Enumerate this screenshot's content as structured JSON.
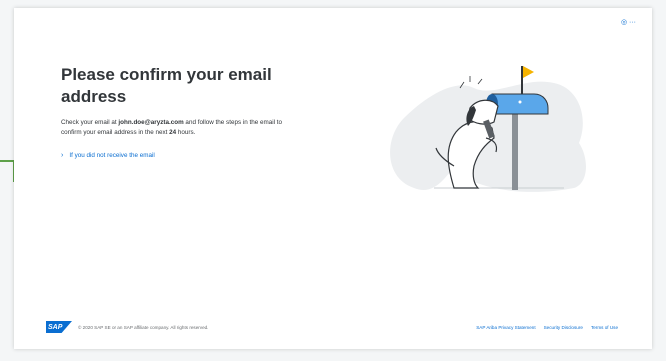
{
  "header": {
    "corner_icon": "settings-icon",
    "corner_glyph": "◎ ···"
  },
  "main": {
    "title": "Please confirm your email address",
    "desc_prefix": "Check your email at ",
    "email": "john.doe@aryzta.com",
    "desc_middle": " and follow the steps in the email to confirm your email address in the next ",
    "hours": "24",
    "desc_suffix": " hours.",
    "link_chevron": "›",
    "link_text": "If you did not receive the email"
  },
  "illustration": {
    "name": "dog-mailbox-illustration",
    "colors": {
      "blob": "#eceef0",
      "mailbox": "#5aa7ea",
      "flag": "#f5b300",
      "outline": "#32363a"
    }
  },
  "footer": {
    "logo_text": "SAP",
    "copyright": "© 2020 SAP SE or an SAP affiliate company. All rights reserved.",
    "links": [
      "SAP Ariba Privacy Statement",
      "Security Disclosure",
      "Terms of Use"
    ]
  },
  "colors": {
    "accent": "#0a6ed1",
    "side_marker": "#5ea14a",
    "text": "#32363a"
  }
}
